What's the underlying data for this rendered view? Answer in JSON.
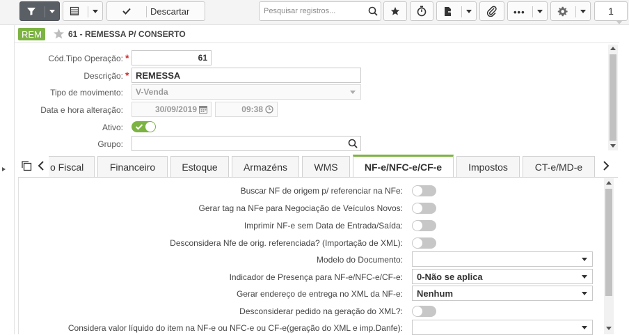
{
  "toolbar": {
    "discard_label": "Descartar",
    "search_placeholder": "Pesquisar registros...",
    "page_number": "1"
  },
  "header": {
    "badge": "REM",
    "title": "61 - REMESSA P/ CONSERTO"
  },
  "form": {
    "cod_tipo_label": "Cód.Tipo Operação:",
    "cod_tipo_value": "61",
    "descricao_label": "Descrição:",
    "descricao_value": "REMESSA",
    "tipo_mov_label": "Tipo de movimento:",
    "tipo_mov_value": "V-Venda",
    "data_label": "Data e hora alteração:",
    "data_value": "30/09/2019",
    "hora_value": "09:38",
    "ativo_label": "Ativo:",
    "ativo_on": true,
    "grupo_label": "Grupo:",
    "grupo_value": ""
  },
  "tabs": [
    {
      "label": "o Fiscal"
    },
    {
      "label": "Financeiro"
    },
    {
      "label": "Estoque"
    },
    {
      "label": "Armazéns"
    },
    {
      "label": "WMS"
    },
    {
      "label": "NF-e/NFC-e/CF-e"
    },
    {
      "label": "Impostos"
    },
    {
      "label": "CT-e/MD-e"
    }
  ],
  "nfe_panel": {
    "buscar_nf_label": "Buscar NF de origem p/ referenciar na NFe:",
    "gerar_tag_label": "Gerar tag na NFe para Negociação de Veículos Novos:",
    "imprimir_label": "Imprimir NF-e sem Data de Entrada/Saída:",
    "desconsidera_label": "Desconsidera Nfe de orig. referenciada? (Importação de XML):",
    "modelo_label": "Modelo do Documento:",
    "modelo_value": "",
    "indicador_label": "Indicador de Presença para NF-e/NFC-e/CF-e:",
    "indicador_value": "0-Não se aplica",
    "gerar_endereco_label": "Gerar endereço de entrega no XML da NF-e:",
    "gerar_endereco_value": "Nenhum",
    "desconsiderar_pedido_label": "Desconsiderar pedido na geração do XML?:",
    "considera_valor_label": "Considera valor líquido do item na NF-e ou NFC-e ou CF-e(geração do XML e imp.Danfe):",
    "considera_valor_value": ""
  },
  "colors": {
    "accent": "#7cb342",
    "required": "#d0302f",
    "toolbar_dark": "#5a5f66"
  }
}
